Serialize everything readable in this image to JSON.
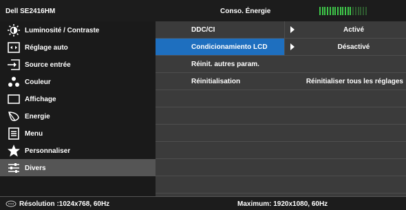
{
  "header": {
    "model": "Dell SE2416HM",
    "section_title": "Conso. Énergie",
    "energy_meter": {
      "segments_total": 19,
      "segments_lit": 13,
      "lit_color": "#3fc94a",
      "unlit_color": "#2f5a30"
    }
  },
  "sidebar": {
    "items": [
      {
        "label": "Luminosité / Contraste",
        "icon": "brightness-icon",
        "selected": false
      },
      {
        "label": "Réglage auto",
        "icon": "auto-adjust-icon",
        "selected": false
      },
      {
        "label": "Source entrée",
        "icon": "input-source-icon",
        "selected": false
      },
      {
        "label": "Couleur",
        "icon": "color-icon",
        "selected": false
      },
      {
        "label": "Affichage",
        "icon": "display-icon",
        "selected": false
      },
      {
        "label": "Energie",
        "icon": "energy-icon",
        "selected": false
      },
      {
        "label": "Menu",
        "icon": "menu-icon",
        "selected": false
      },
      {
        "label": "Personnaliser",
        "icon": "star-icon",
        "selected": false
      },
      {
        "label": "Divers",
        "icon": "sliders-icon",
        "selected": true
      }
    ]
  },
  "content": {
    "rows": [
      {
        "label": "DDC/CI",
        "value": "Activé",
        "has_arrow": true,
        "active": false
      },
      {
        "label": "Condicionamiento LCD",
        "value": "Désactivé",
        "has_arrow": true,
        "active": true
      },
      {
        "label": "Réinit. autres param.",
        "value": "",
        "has_arrow": false,
        "active": false
      },
      {
        "label": "Réinitialisation",
        "value": "Réinitialiser tous les réglages",
        "has_arrow": false,
        "active": false
      }
    ],
    "empty_rows": 6
  },
  "footer": {
    "resolution": "Résolution :1024x768, 60Hz",
    "maximum": "Maximum: 1920x1080, 60Hz",
    "icon": "monitor-input-icon"
  },
  "colors": {
    "accent": "#1e6fbf",
    "sidebar_bg": "#1a1a1a",
    "selected_bg": "#555555",
    "content_bg": "#3b3b3b"
  }
}
